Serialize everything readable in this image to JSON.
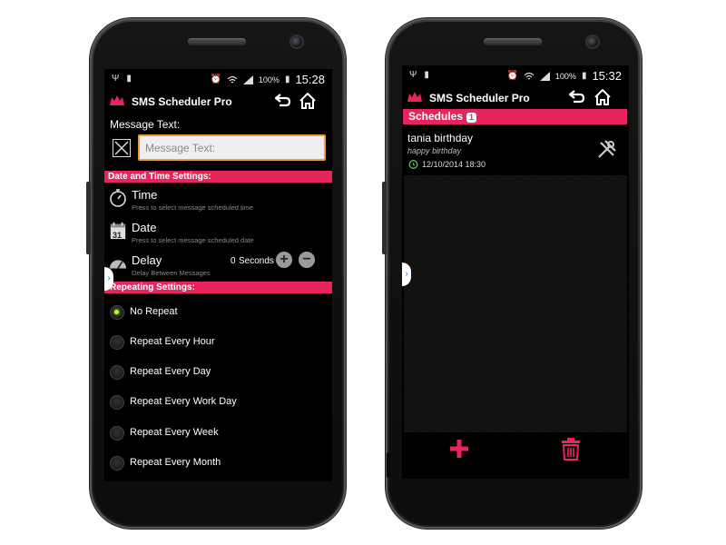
{
  "left_screen": {
    "status_time": "15:28",
    "battery": "100%",
    "app_title": "SMS Scheduler Pro",
    "message_label": "Message Text:",
    "message_placeholder": "Message Text:",
    "datetime_section": "Date and Time Settings:",
    "time_title": "Time",
    "time_sub": "Press to select message scheduled time",
    "date_title": "Date",
    "date_sub": "Press to select message scheduled date",
    "date_icon_num": "31",
    "delay_title": "Delay",
    "delay_sub": "Delay Between Messages",
    "delay_value": "0",
    "delay_unit": "Seconds",
    "repeating_section": "Repeating Settings:",
    "repeat_options": [
      {
        "label": "No Repeat",
        "selected": true
      },
      {
        "label": "Repeat Every Hour",
        "selected": false
      },
      {
        "label": "Repeat Every Day",
        "selected": false
      },
      {
        "label": "Repeat Every Work Day",
        "selected": false
      },
      {
        "label": "Repeat Every Week",
        "selected": false
      },
      {
        "label": "Repeat Every Month",
        "selected": false
      }
    ]
  },
  "right_screen": {
    "status_time": "15:32",
    "battery": "100%",
    "app_title": "SMS Scheduler Pro",
    "schedules_label": "Schedules",
    "schedules_count": "1",
    "item": {
      "title": "tania birthday",
      "message": "happy birthday",
      "datetime": "12/10/2014 18:30"
    }
  },
  "colors": {
    "accent": "#e8245e",
    "field_border": "#e9a03a",
    "radio_on": "#b3ff2e",
    "alarm_green": "#55c94a"
  },
  "icons": [
    "usb-icon",
    "battery-icon",
    "alarm-icon",
    "wifi-icon",
    "signal-icon",
    "back-icon",
    "home-icon",
    "stopwatch-icon",
    "calendar-icon",
    "speedometer-icon",
    "plus-icon",
    "minus-icon",
    "wrench-icon",
    "add-icon",
    "trash-icon"
  ]
}
